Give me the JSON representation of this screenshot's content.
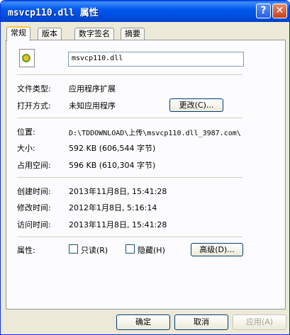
{
  "window": {
    "title": "msvcp110.dll 属性",
    "help_label": "?",
    "close_label": "✕"
  },
  "tabs": [
    "常规",
    "版本",
    "数字签名",
    "摘要"
  ],
  "general": {
    "file_name": "msvcp110.dll",
    "file_type_label": "文件类型:",
    "file_type": "应用程序扩展",
    "open_with_label": "打开方式:",
    "open_with": "未知应用程序",
    "change_button": "更改(C)...",
    "location_label": "位置:",
    "location": "D:\\TDDOWNLOAD\\上传\\msvcp110.dll_3987.com\\",
    "size_label": "大小:",
    "size": "592 KB (606,544 字节)",
    "size_on_disk_label": "占用空间:",
    "size_on_disk": "596 KB (610,304 字节)",
    "created_label": "创建时间:",
    "created": "2013年11月8日, 15:41:28",
    "modified_label": "修改时间:",
    "modified": "2012年1月8日, 5:16:14",
    "accessed_label": "访问时间:",
    "accessed": "2013年11月8日, 15:41:28",
    "attributes_label": "属性:",
    "readonly_label": "只读(R)",
    "hidden_label": "隐藏(H)",
    "advanced_button": "高级(D)..."
  },
  "footer": {
    "ok": "确定",
    "cancel": "取消",
    "apply": "应用(A)"
  }
}
